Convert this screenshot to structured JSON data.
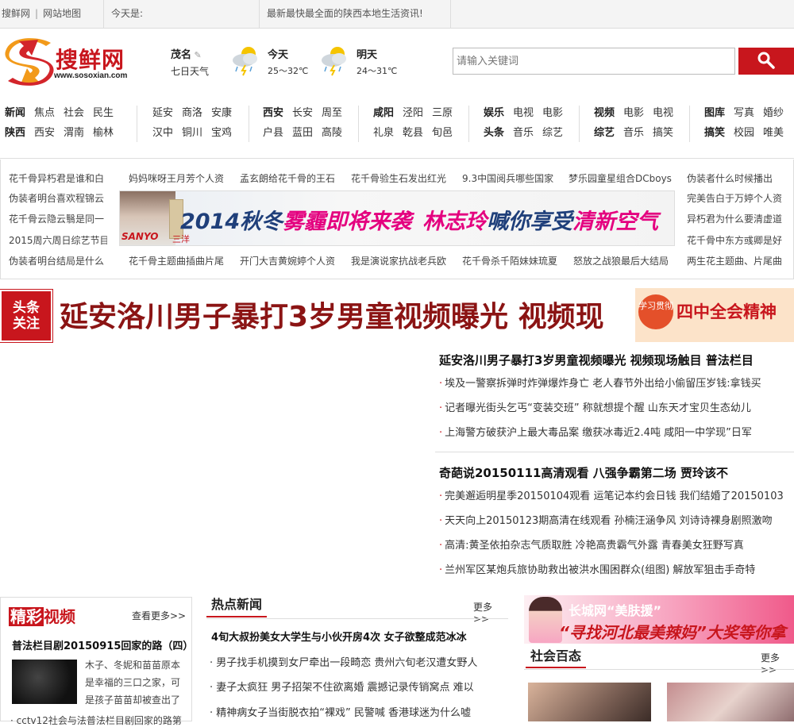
{
  "topbar": {
    "site_name": "搜鲜网",
    "sitemap": "网站地图",
    "today_label": "今天是:",
    "slogan": "最新最快最全面的陕西本地生活资讯!"
  },
  "logo": {
    "name": "搜鲜网",
    "url": "www.sosoxian.com"
  },
  "weather": {
    "city": "茂名",
    "seven_day": "七日天气",
    "today": {
      "label": "今天",
      "temp": "25～32℃"
    },
    "tomorrow": {
      "label": "明天",
      "temp": "24～31℃"
    }
  },
  "search": {
    "placeholder": "请输入关键词"
  },
  "nav": [
    {
      "row1": [
        "新闻",
        "焦点",
        "社会",
        "民生"
      ],
      "row2": [
        "陕西",
        "西安",
        "渭南",
        "榆林"
      ]
    },
    {
      "row1": [
        "延安",
        "商洛",
        "安康"
      ],
      "row2": [
        "汉中",
        "铜川",
        "宝鸡"
      ]
    },
    {
      "row1": [
        "西安",
        "长安",
        "周至"
      ],
      "row2": [
        "户县",
        "蓝田",
        "高陵"
      ]
    },
    {
      "row1": [
        "咸阳",
        "泾阳",
        "三原"
      ],
      "row2": [
        "礼泉",
        "乾县",
        "旬邑"
      ]
    },
    {
      "row1": [
        "娱乐",
        "电视",
        "电影"
      ],
      "row2": [
        "头条",
        "音乐",
        "综艺"
      ]
    },
    {
      "row1": [
        "视频",
        "电影",
        "电视"
      ],
      "row2": [
        "综艺",
        "音乐",
        "搞笑"
      ]
    },
    {
      "row1": [
        "图库",
        "写真",
        "婚纱"
      ],
      "row2": [
        "搞笑",
        "校园",
        "唯美"
      ]
    }
  ],
  "ticker": {
    "left": [
      "花千骨异朽君是谁和白",
      "伪装者明台喜欢程锦云",
      "花千骨云隐云翳是同一",
      "2015周六周日综艺节目",
      "伪装者明台结局是什么"
    ],
    "top": [
      "妈妈咪呀王月芳个人资",
      "孟玄朗给花千骨的王石",
      "花千骨验生石发出红光",
      "9.3中国阅兵哪些国家",
      "梦乐园童星组合DCboys"
    ],
    "right": [
      "伪装者什么时候播出",
      "完美告白于万婷个人资",
      "异朽君为什么要清虚道",
      "花千骨中东方彧卿是好",
      "两生花主题曲、片尾曲"
    ],
    "bottom": [
      "花千骨主题曲插曲片尾",
      "开门大吉黄婉婷个人资",
      "我是演说家抗战老兵欧",
      "花千骨杀千陌妹妹琉夏",
      "怒放之战狼最后大结局"
    ]
  },
  "banner": {
    "brand": "SANYO",
    "brand_cn": "三洋",
    "text_a": "2014秋冬",
    "text_b": "雾霾即将来袭",
    "text_c": "林志玲",
    "text_d": "喊你享受",
    "text_e": "清新空气"
  },
  "headline": {
    "badge_line1": "头条",
    "badge_line2": "关注",
    "title": "延安洛川男子暴打3岁男童视频曝光 视频现",
    "side_ad_circle": "学习贯彻",
    "side_ad_text": "四中全会精神"
  },
  "news": {
    "group1": {
      "title": "延安洛川男子暴打3岁男童视频曝光 视频现场触目 普法栏目",
      "items": [
        "埃及一警察拆弹时炸弹爆炸身亡 老人春节外出给小偷留压岁钱:拿钱买",
        "记者曝光街头乞丐“变装交班” 称就想提个醒 山东天才宝贝生态幼儿",
        "上海警方破获沪上最大毒品案 缴获冰毒近2.4吨 咸阳一中学现”日军"
      ]
    },
    "group2": {
      "title": "奇葩说20150111高清观看 八强争霸第二场 贾玲该不",
      "items": [
        "完美邂逅明星季20150104观看 运笔记本约会日钱 我们结婚了20150103",
        "天天向上20150123期高清在线观看 孙楠汪涵争风 刘诗诗裸身剧照激吻",
        "高清:黄圣依拍杂志气质取胜 冷艳高贵霸气外露 青春美女狂野写真",
        "兰州军区某炮兵旅协助救出被洪水围困群众(组图) 解放军狙击手奇特"
      ]
    }
  },
  "video": {
    "title_a": "精彩",
    "title_b": "视频",
    "more": "查看更多>>",
    "headline": "普法栏目剧20150915回家的路（四）",
    "desc": "木子、冬妮和苗苗原本是幸福的三口之家，可是孩子苗苗却被查出了",
    "footer": "· cctv12社会与法普法栏目剧回家的路第"
  },
  "hot": {
    "tab": "热点新闻",
    "more": "更多>>",
    "headline": "4旬大叔扮美女大学生与小伙开房4次 女子欲整成范冰冰",
    "items": [
      "男子找手机摸到女尸牵出一段畸恋 贵州六旬老汉遭女野人",
      "妻子太疯狂 男子招架不住欲离婚 震撼记录传销窝点 难以",
      "精神病女子当街脱衣拍“裸戏” 民警喊 香港球迷为什么嘘"
    ]
  },
  "right_ad": {
    "line1": "长城网“美肤援”",
    "line2": "“寻找河北最美辣妈”大奖等你拿"
  },
  "social": {
    "tab": "社会百态",
    "more": "更多>>"
  },
  "colors": {
    "accent": "#c8161d",
    "headline": "#8b1414"
  }
}
